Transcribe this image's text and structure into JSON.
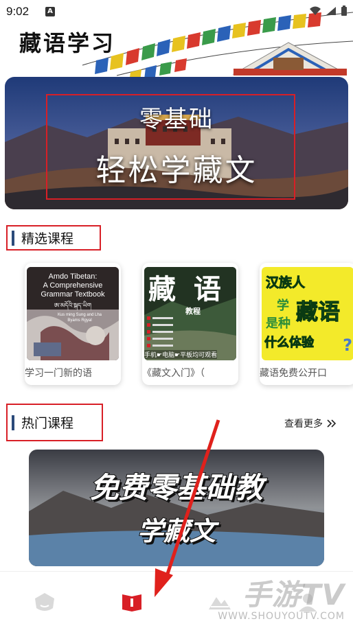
{
  "status_bar": {
    "time": "9:02",
    "notification_icon": "A"
  },
  "app": {
    "title": "藏语学习"
  },
  "hero": {
    "line1": "零基础",
    "line2": "轻松学藏文"
  },
  "featured": {
    "section_title": "精选课程",
    "courses": [
      {
        "label": "学习一门新的语",
        "thumb_lines": [
          "Amdo Tibetan:",
          "A Comprehensive",
          "Grammar Textbook"
        ],
        "thumb_sub": "ཨ་མདོའི་སྐད་ཡིག",
        "thumb_author": "Kus ming Sung and Lha Byams Rgyal"
      },
      {
        "label": "《藏文入门》（",
        "thumb_title": "藏 语",
        "thumb_sub": "教程",
        "thumb_footer": "手机☛电脑☛平板均可观看"
      },
      {
        "label": "藏语免费公开口",
        "thumb_line1": "汉族人",
        "thumb_line2": "学",
        "thumb_line3": "藏语",
        "thumb_line4": "是种",
        "thumb_line5": "什么体验",
        "thumb_q": "?"
      }
    ]
  },
  "hot": {
    "section_title": "热门课程",
    "more_label": "查看更多",
    "banner_line1": "免费零基础教",
    "banner_line2": "学藏文"
  },
  "watermark": {
    "main": "手游TV",
    "sub": "WWW.SHOUYOUTV.COM"
  },
  "colors": {
    "accent_red": "#d81f26",
    "section_bar": "#2b4a7a"
  },
  "icons": [
    "home-icon",
    "book-icon",
    "mountain-icon",
    "profile-icon"
  ]
}
